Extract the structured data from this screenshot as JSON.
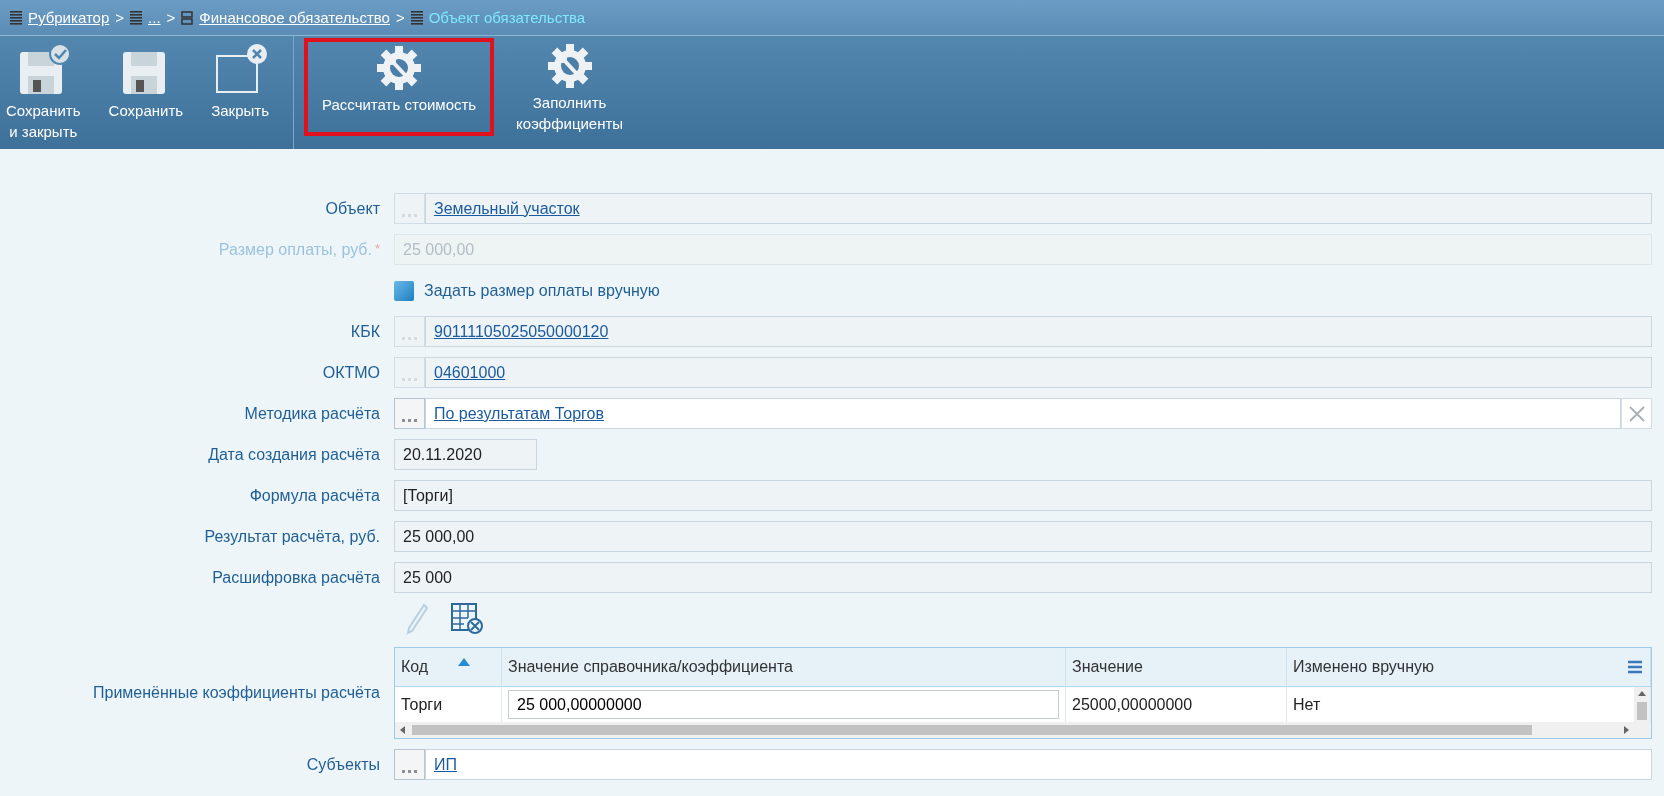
{
  "breadcrumbs": [
    {
      "label": "Рубрикатор",
      "link": true,
      "separator": ">"
    },
    {
      "label": "...",
      "link": true,
      "separator": ">"
    },
    {
      "label": "Финансовое обязательство",
      "link": true,
      "separator": ">"
    },
    {
      "label": "Объект обязательства",
      "link": false
    }
  ],
  "toolbar": {
    "groups": [
      [
        {
          "label": "Сохранить\nи закрыть",
          "kind": "save_close",
          "highlighted": false
        },
        {
          "label": "Сохранить",
          "kind": "save",
          "highlighted": false
        },
        {
          "label": "Закрыть",
          "kind": "close",
          "highlighted": false
        }
      ],
      [
        {
          "label": "Рассчитать стоимость",
          "kind": "gear",
          "highlighted": true
        },
        {
          "label": "Заполнить\nкоэффициенты",
          "kind": "gear",
          "highlighted": false
        }
      ]
    ]
  },
  "form": {
    "fields": [
      {
        "kind": "lookup",
        "label": "Объект",
        "value": "Земельный участок",
        "disabled": true,
        "clearable": false
      },
      {
        "kind": "text",
        "label": "Размер оплаты, руб.",
        "value": "25 000,00",
        "disabled": true,
        "required_mark": "*"
      },
      {
        "kind": "checkbox",
        "label": "Задать размер оплаты вручную",
        "checked": false
      },
      {
        "kind": "lookup",
        "label": "КБК",
        "value": "90111105025050000120",
        "disabled": true,
        "clearable": false
      },
      {
        "kind": "lookup",
        "label": "ОКТМО",
        "value": "04601000",
        "disabled": true,
        "clearable": false
      },
      {
        "kind": "lookup",
        "label": "Методика расчёта",
        "value": "По результатам Торгов",
        "disabled": false,
        "clearable": true
      },
      {
        "kind": "date",
        "label": "Дата создания расчёта",
        "value": "20.11.2020",
        "disabled": false
      },
      {
        "kind": "text",
        "label": "Формула расчёта",
        "value": "[Торги]",
        "disabled": false
      },
      {
        "kind": "text",
        "label": "Результат расчёта, руб.",
        "value": "25 000,00",
        "disabled": false
      },
      {
        "kind": "text",
        "label": "Расшифровка расчёта",
        "value": "25 000",
        "disabled": false
      },
      {
        "kind": "grid",
        "label": "Применённые коэффициенты расчёта",
        "tools": [
          {
            "kind": "edit",
            "disabled": true
          },
          {
            "kind": "delete",
            "disabled": false
          }
        ],
        "columns": [
          {
            "label": "Код",
            "sorted": true
          },
          {
            "label": "Значение справочника/коэффициента",
            "sorted": false
          },
          {
            "label": "Значение",
            "sorted": false
          },
          {
            "label": "Изменено вручную",
            "sorted": false
          }
        ],
        "rows": [
          {
            "cells": [
              {
                "text": "Торги",
                "editing": false
              },
              {
                "text": "25 000,00000000",
                "editing": true
              },
              {
                "text": "25000,00000000",
                "editing": false
              },
              {
                "text": "Нет",
                "editing": false
              }
            ]
          }
        ]
      },
      {
        "kind": "lookup",
        "label": "Субъекты",
        "value": "ИП",
        "disabled": false,
        "clearable": false
      }
    ]
  }
}
